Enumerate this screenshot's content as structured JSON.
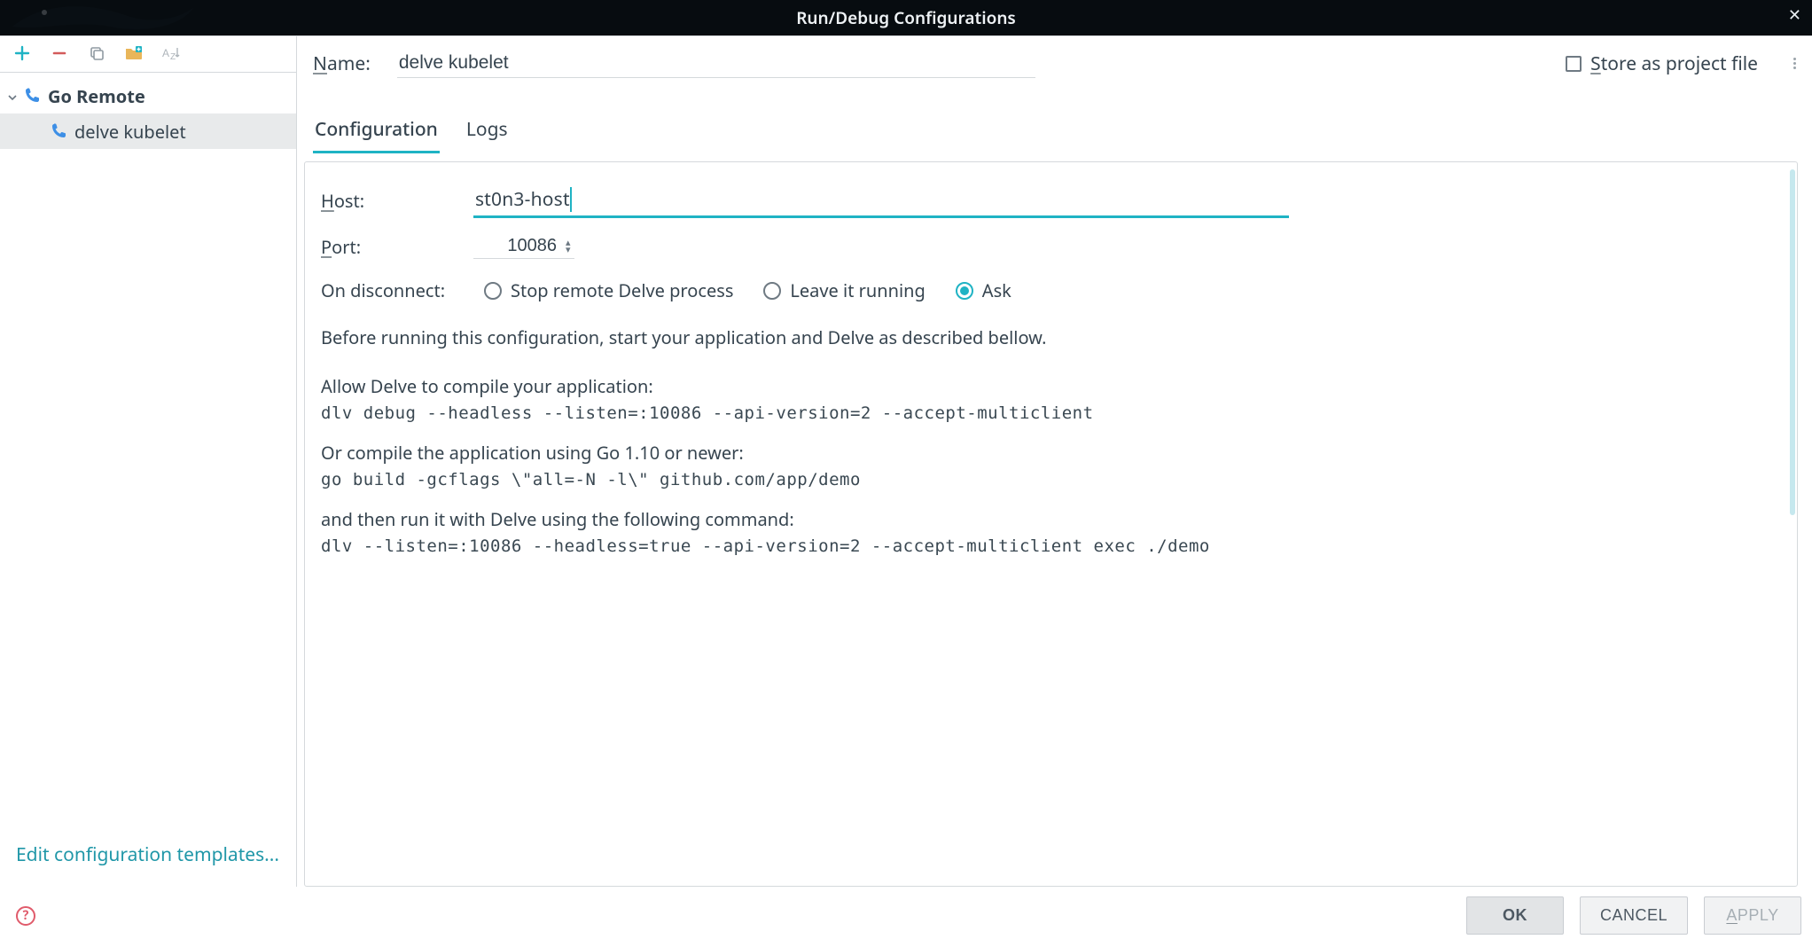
{
  "titlebar": {
    "title": "Run/Debug Configurations"
  },
  "toolbar": {
    "add_tip": "Add",
    "remove_tip": "Remove",
    "copy_tip": "Copy",
    "folder_tip": "New Folder",
    "sort_tip": "Sort"
  },
  "tree": {
    "parent_label": "Go Remote",
    "selected_label": "delve kubelet"
  },
  "sidebar_footer": {
    "edit_templates": "Edit configuration templates..."
  },
  "header": {
    "name_label": "Name:",
    "name_value": "delve kubelet",
    "store_label": "Store as project file"
  },
  "tabs": {
    "configuration": "Configuration",
    "logs": "Logs"
  },
  "form": {
    "host_label": "Host:",
    "host_value": "st0n3-host",
    "port_label": "Port:",
    "port_value": "10086",
    "disconnect_label": "On disconnect:",
    "radio_stop": "Stop remote Delve process",
    "radio_leave": "Leave it running",
    "radio_ask": "Ask",
    "radio_selected": "ask",
    "help_intro": "Before running this configuration, start your application and Delve as described bellow.",
    "help_compile": "Allow Delve to compile your application:",
    "code_debug": "dlv debug --headless --listen=:10086 --api-version=2 --accept-multiclient",
    "help_or": "Or compile the application using Go 1.10 or newer:",
    "code_build": "go build -gcflags \\\"all=-N -l\\\" github.com/app/demo",
    "help_then": "and then run it with Delve using the following command:",
    "code_exec": "dlv --listen=:10086 --headless=true --api-version=2 --accept-multiclient exec ./demo"
  },
  "footer": {
    "ok": "OK",
    "cancel": "CANCEL",
    "apply": "APPLY"
  }
}
